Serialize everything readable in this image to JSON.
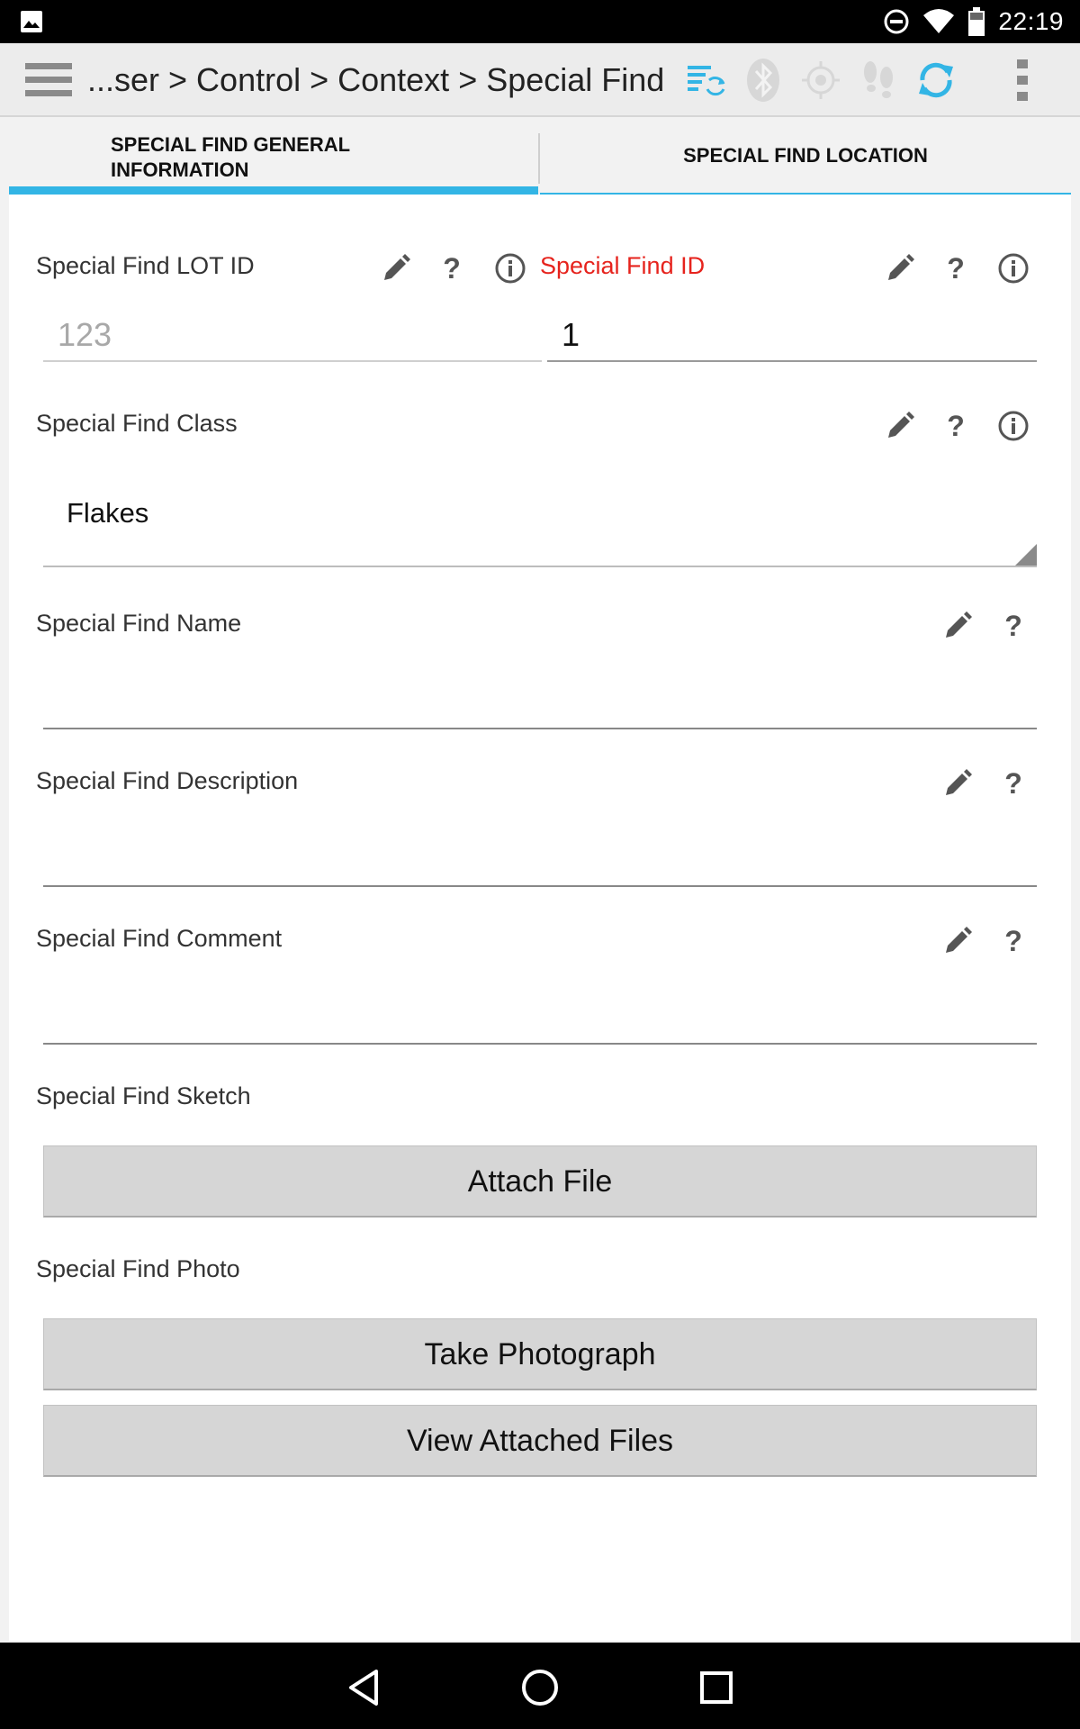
{
  "status_bar": {
    "time": "22:19",
    "icons": [
      "image-notification-icon",
      "do-not-disturb-icon",
      "wifi-icon",
      "battery-icon"
    ]
  },
  "action_bar": {
    "breadcrumb": "...ser > Control > Context > Special Find",
    "icons": [
      "menu-icon",
      "sync-list-icon",
      "bluetooth-icon",
      "gps-icon",
      "tracklog-icon",
      "refresh-icon",
      "overflow-menu-icon"
    ],
    "accent_color": "#33b5e5"
  },
  "tabs": [
    {
      "label": "SPECIAL FIND GENERAL INFORMATION",
      "selected": true
    },
    {
      "label": "SPECIAL FIND LOCATION",
      "selected": false
    }
  ],
  "form": {
    "lot_id": {
      "label": "Special Find LOT ID",
      "value": "123"
    },
    "find_id": {
      "label": "Special Find ID",
      "value": "1",
      "label_color": "#e6231d"
    },
    "find_class": {
      "label": "Special Find Class",
      "value": "Flakes"
    },
    "find_name": {
      "label": "Special Find Name",
      "value": ""
    },
    "find_description": {
      "label": "Special Find Description",
      "value": ""
    },
    "find_comment": {
      "label": "Special Find Comment",
      "value": ""
    },
    "find_sketch": {
      "label": "Special Find Sketch",
      "button": "Attach File"
    },
    "find_photo": {
      "label": "Special Find Photo",
      "take_button": "Take Photograph",
      "view_button": "View Attached Files"
    },
    "help_glyph": "?"
  },
  "nav_bar": {
    "icons": [
      "back-icon",
      "home-icon",
      "recents-icon"
    ]
  }
}
